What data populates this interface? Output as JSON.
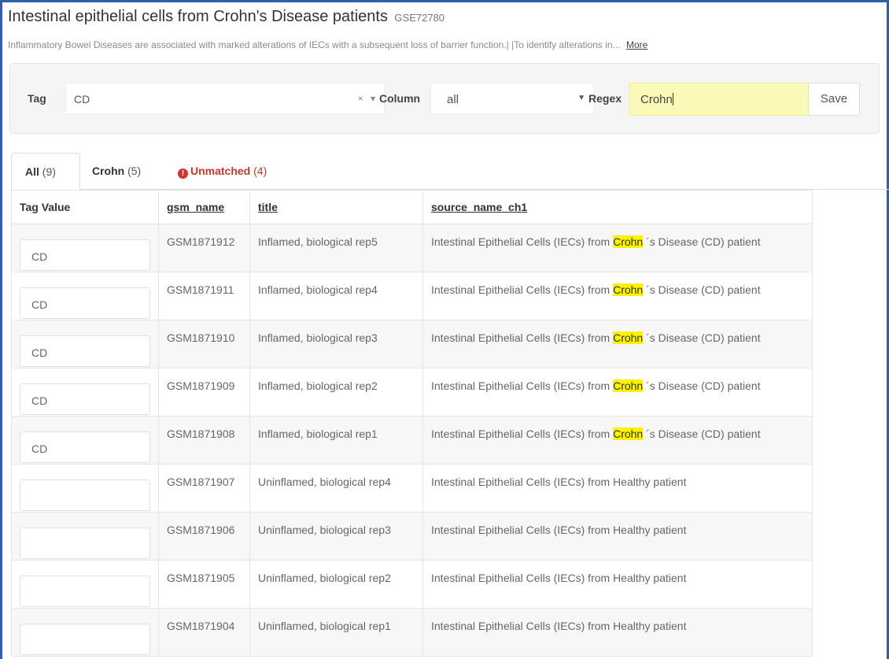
{
  "header": {
    "title": "Intestinal epithelial cells from Crohn's Disease patients",
    "gse": "GSE72780",
    "summary": "Inflammatory Bowel Diseases are associated with marked alterations of IECs with a subsequent loss of barrier function.| |To identify alterations in...",
    "more_label": "More"
  },
  "filters": {
    "tag_label": "Tag",
    "tag_value": "CD",
    "tag_controls": "× ▾",
    "column_label": "Column",
    "column_value": "all",
    "regex_label": "Regex",
    "regex_value": "Crohn",
    "save_label": "Save"
  },
  "tabs": [
    {
      "label": "All",
      "count": "(9)"
    },
    {
      "label": "Crohn",
      "count": "(5)"
    },
    {
      "label": "Unmatched",
      "count": "(4)"
    }
  ],
  "table": {
    "headers": [
      "Tag Value",
      "gsm_name",
      "title",
      "source_name_ch1"
    ],
    "source_parts": {
      "crohn_pre": "Intestinal Epithelial Cells (IECs) from ",
      "crohn_match": "Crohn",
      "crohn_post": " ´s Disease (CD) patient",
      "healthy": "Intestinal Epithelial Cells (IECs) from Healthy patient"
    },
    "rows": [
      {
        "tag": "CD",
        "gsm": "GSM1871912",
        "title": "Inflamed, biological rep5"
      },
      {
        "tag": "CD",
        "gsm": "GSM1871911",
        "title": "Inflamed, biological rep4"
      },
      {
        "tag": "CD",
        "gsm": "GSM1871910",
        "title": "Inflamed, biological rep3"
      },
      {
        "tag": "CD",
        "gsm": "GSM1871909",
        "title": "Inflamed, biological rep2"
      },
      {
        "tag": "CD",
        "gsm": "GSM1871908",
        "title": "Inflamed, biological rep1"
      },
      {
        "tag": "",
        "gsm": "GSM1871907",
        "title": "Uninflamed, biological rep4"
      },
      {
        "tag": "",
        "gsm": "GSM1871906",
        "title": "Uninflamed, biological rep3"
      },
      {
        "tag": "",
        "gsm": "GSM1871905",
        "title": "Uninflamed, biological rep2"
      },
      {
        "tag": "",
        "gsm": "GSM1871904",
        "title": "Uninflamed, biological rep1"
      }
    ]
  },
  "colors": {
    "highlight": "#fef200",
    "regex_bg": "#fbf9b7",
    "unmatched": "#c0392b",
    "frame": "#2f5fa8"
  }
}
